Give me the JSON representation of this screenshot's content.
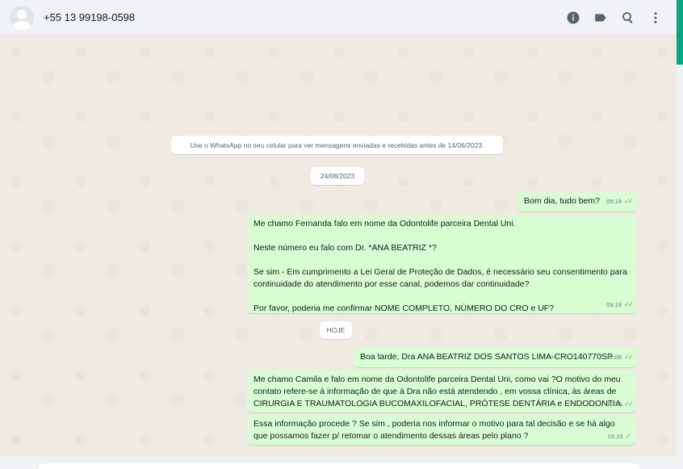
{
  "header": {
    "contact_name": "+55 13 99198-0598",
    "icons": [
      "info-icon",
      "label-icon",
      "search-icon",
      "menu-icon"
    ]
  },
  "system_notice": "Use o WhatsApp no seu celular para ver mensagens enviadas e recebidas antes de 14/06/2023.",
  "date_separators": [
    "24/08/2023",
    "HOJE"
  ],
  "messages": [
    {
      "text": "Bom dia, tudo bem?",
      "time": "09:18",
      "status": "double-check"
    },
    {
      "text": "Me chamo Fernanda falo em nome da Odontolife parceira Dental Uni.\n\nNeste número eu falo com Dr. *ANA BEATRIZ *?\n\nSe sim - Em cumprimento a Lei Geral de Proteção de Dados, é necessário seu consentimento para continuidade do atendimento por esse canal, podemos dar continuidade?\n\nPor favor, poderia me confirmar NOME COMPLETO, NÚMERO DO CRO e UF?",
      "time": "09:18",
      "status": "double-check"
    },
    {
      "text": "Boa tarde, Dra ANA BEATRIZ DOS SANTOS LIMA-CRO140770SP",
      "time": "16:08",
      "status": "double-check"
    },
    {
      "text": "Me chamo Camila e falo em nome da Odontolife parceira Dental Uni, como vai ?O motivo do meu contato refere-se à informação de que à Dra não está atendendo , em vossa clínica, às áreas de CIRURGIA E TRAUMATOLOGIA BUCOMAXILOFACIAL, PRÓTESE DENTÁRIA e ENDODONTIA.",
      "time": "16:10",
      "status": "double-check"
    },
    {
      "text": "Essa informação procede ? Se sim , poderia nos informar o motivo para tal decisão e se há algo que possamos fazer p/ retomar o atendimento dessas áreas pelo plano ?",
      "time": "16:10",
      "status": "single-check"
    }
  ],
  "colors": {
    "outgoing_bubble": "#d9fdd3",
    "chat_background": "#efeae2",
    "header_background": "#f0f2f5",
    "accent": "#00a884"
  }
}
